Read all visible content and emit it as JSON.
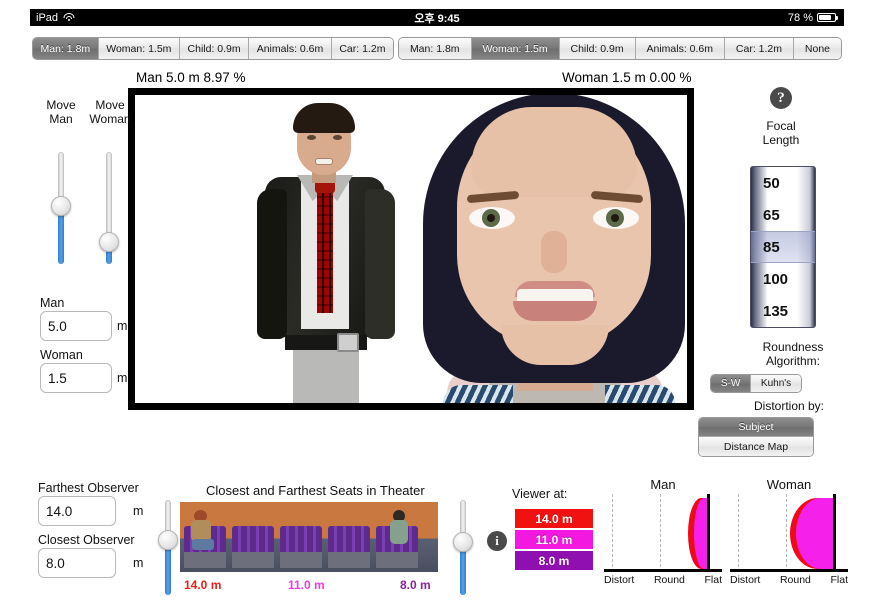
{
  "status_bar": {
    "device": "iPad",
    "wifi_icon": "wifi-icon",
    "time": "오후 9:45",
    "battery_percent": "78 %",
    "battery_icon": "battery-icon"
  },
  "tab_bar_left": {
    "name": "subject-selector-left",
    "items": [
      {
        "label": "Man: 1.8m",
        "active": true
      },
      {
        "label": "Woman: 1.5m",
        "active": false
      },
      {
        "label": "Child: 0.9m",
        "active": false
      },
      {
        "label": "Animals: 0.6m",
        "active": false
      },
      {
        "label": "Car: 1.2m",
        "active": false
      }
    ]
  },
  "tab_bar_right": {
    "name": "subject-selector-right",
    "items": [
      {
        "label": "Man: 1.8m",
        "active": false
      },
      {
        "label": "Woman: 1.5m",
        "active": true
      },
      {
        "label": "Child: 0.9m",
        "active": false
      },
      {
        "label": "Animals: 0.6m",
        "active": false
      },
      {
        "label": "Car: 1.2m",
        "active": false
      },
      {
        "label": "None",
        "active": false
      }
    ]
  },
  "readouts": {
    "man": "Man 5.0 m  8.97 %",
    "woman": "Woman 1.5 m  0.00 %"
  },
  "left_panel": {
    "move_man_label_line1": "Move",
    "move_man_label_line2": "Man",
    "move_woman_label_line1": "Move",
    "move_woman_label_line2": "Woman",
    "slider_man": {
      "name": "move-man-slider",
      "fill_percent": 52,
      "knob_percent": 52
    },
    "slider_woman": {
      "name": "move-woman-slider",
      "fill_percent": 20,
      "knob_percent": 20
    },
    "man_field": {
      "caption": "Man",
      "value": "5.0",
      "unit": "m"
    },
    "woman_field": {
      "caption": "Woman",
      "value": "1.5",
      "unit": "m"
    }
  },
  "right_panel": {
    "help_icon_glyph": "?",
    "focal_label_line1": "Focal",
    "focal_label_line2": "Length",
    "focal_options": [
      {
        "value": "50",
        "selected": false
      },
      {
        "value": "65",
        "selected": false
      },
      {
        "value": "85",
        "selected": true
      },
      {
        "value": "100",
        "selected": false
      },
      {
        "value": "135",
        "selected": false
      }
    ],
    "roundness_label_line1": "Roundness",
    "roundness_label_line2": "Algorithm:",
    "roundness_options": [
      {
        "label": "S-W",
        "active": true
      },
      {
        "label": "Kuhn's",
        "active": false
      }
    ],
    "distortion_label": "Distortion by:",
    "distortion_options": [
      {
        "label": "Subject",
        "active": true
      },
      {
        "label": "Distance Map",
        "active": false
      }
    ]
  },
  "bottom_panel": {
    "farthest_field": {
      "caption": "Farthest Observer",
      "value": "14.0",
      "unit": "m"
    },
    "closest_field": {
      "caption": "Closest Observer",
      "value": "8.0",
      "unit": "m"
    },
    "slider_farthest": {
      "name": "farthest-observer-slider",
      "fill_percent": 58,
      "knob_percent": 58
    },
    "slider_closest": {
      "name": "closest-observer-slider",
      "fill_percent": 56,
      "knob_percent": 56
    },
    "theater_title": "Closest and Farthest Seats in Theater",
    "theater_distances": [
      {
        "label": "14.0 m",
        "color": "#e8201a"
      },
      {
        "label": "11.0 m",
        "color": "#e840d8"
      },
      {
        "label": "8.0 m",
        "color": "#8a1fa8"
      }
    ],
    "viewer_label": "Viewer at:",
    "info_icon_glyph": "i",
    "viewer_buttons": [
      {
        "label": "14.0 m",
        "color": "#f21111"
      },
      {
        "label": "11.0 m",
        "color": "#f318e0"
      },
      {
        "label": "8.0 m",
        "color": "#8f0fb0"
      }
    ]
  },
  "chart_data": [
    {
      "type": "area",
      "name": "man-roundness-chart",
      "title": "Man",
      "categories": [
        "Distort",
        "Round",
        "Flat"
      ],
      "xlabel": "",
      "ylabel": "",
      "grid": true,
      "series": [
        {
          "name": "red-lobe",
          "color": "#ee0b18",
          "extent_from_flat": 0.17,
          "height_fraction": 1.0
        },
        {
          "name": "magenta-lobe",
          "color": "#f520ea",
          "extent_from_flat": 0.13,
          "height_fraction": 1.0
        }
      ],
      "values": [
        0,
        0,
        1.0
      ],
      "peak_category": "Flat"
    },
    {
      "type": "area",
      "name": "woman-roundness-chart",
      "title": "Woman",
      "categories": [
        "Distort",
        "Round",
        "Flat"
      ],
      "xlabel": "",
      "ylabel": "",
      "grid": true,
      "series": [
        {
          "name": "red-lobe",
          "color": "#ee0b18",
          "extent_from_flat": 0.42,
          "height_fraction": 1.0
        },
        {
          "name": "magenta-lobe",
          "color": "#f520ea",
          "extent_from_flat": 0.38,
          "height_fraction": 1.0
        }
      ],
      "values": [
        0,
        0,
        1.0
      ],
      "peak_category": "Flat"
    }
  ]
}
